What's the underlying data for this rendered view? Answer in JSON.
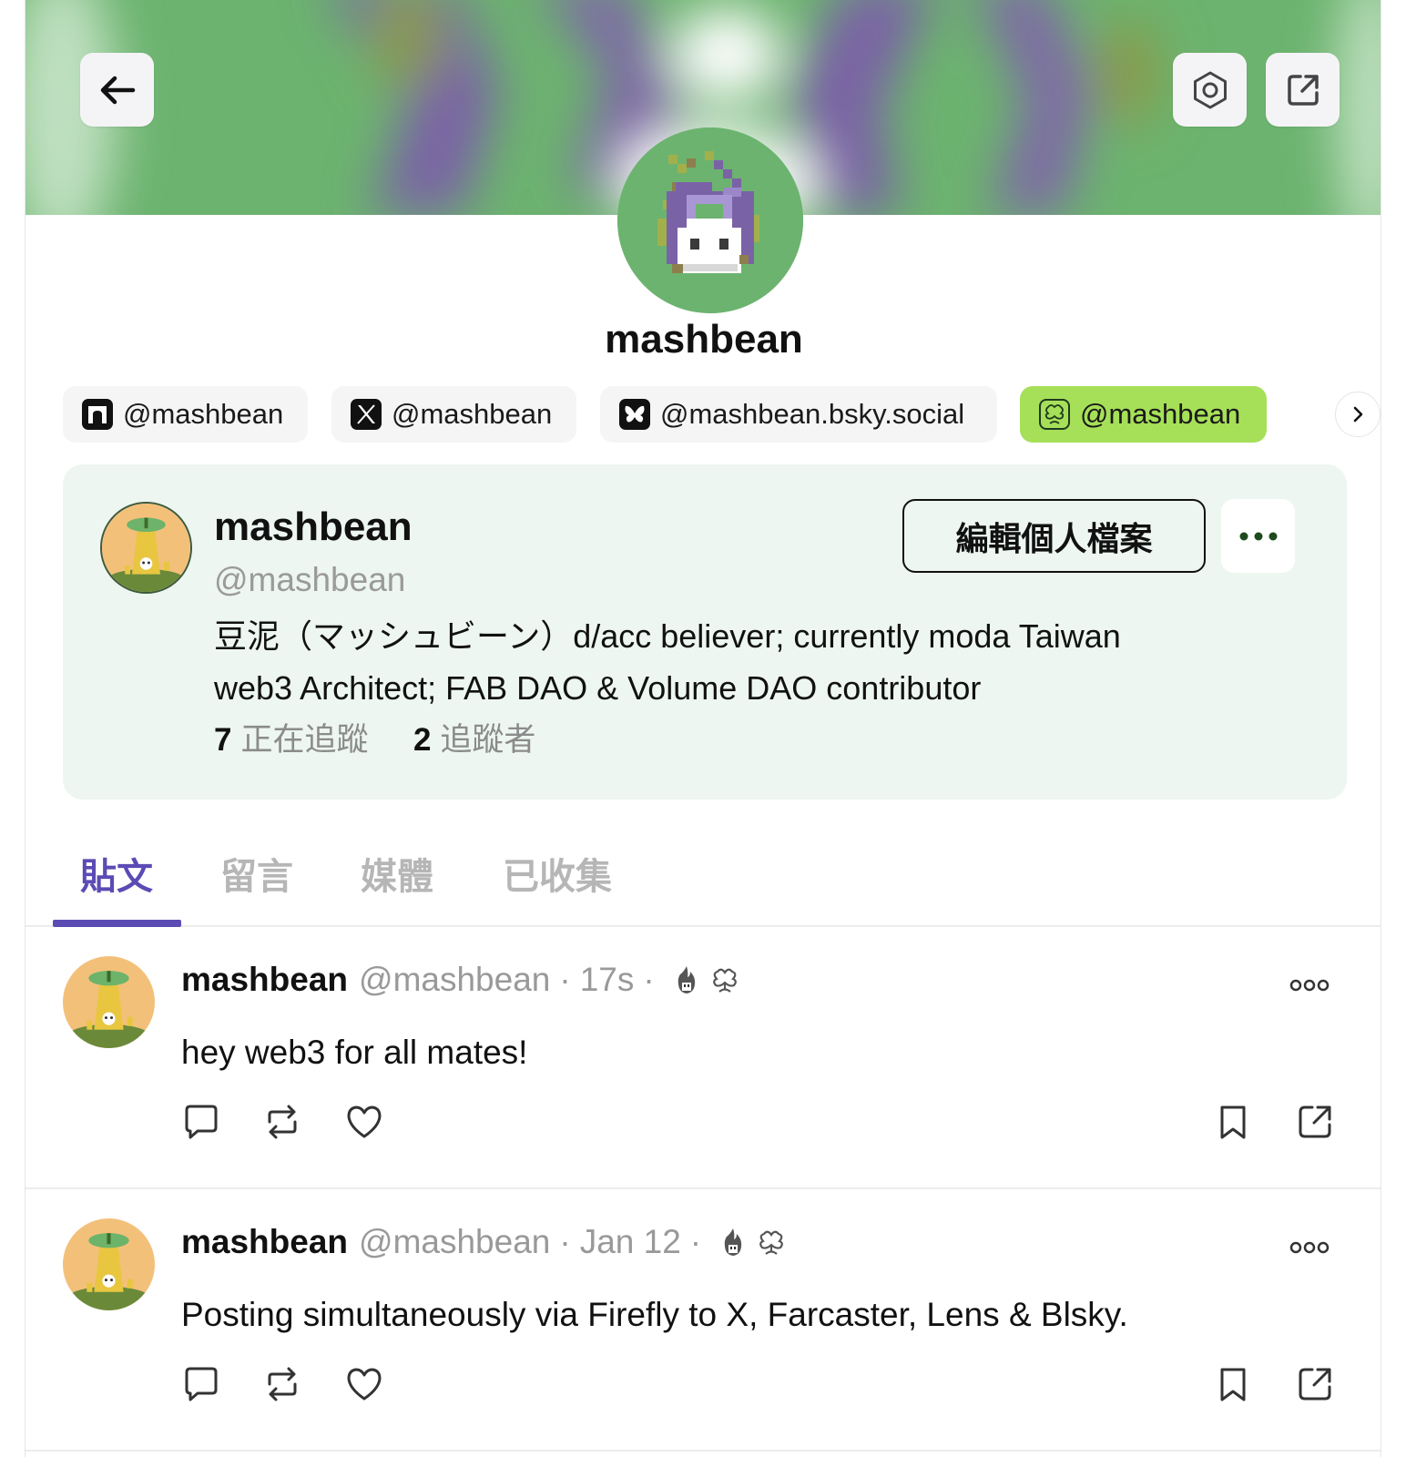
{
  "header": {
    "back_icon": "arrow-left-icon",
    "settings_icon": "gear-icon",
    "share_icon": "external-share-icon",
    "banner_colors": [
      "#6cb36f",
      "#7a62a6",
      "#ffffff"
    ]
  },
  "profile": {
    "display_name": "mashbean"
  },
  "social_chips": [
    {
      "platform_icon": "farcaster-icon",
      "label": "@mashbean"
    },
    {
      "platform_icon": "x-icon",
      "label": "@mashbean"
    },
    {
      "platform_icon": "bluesky-icon",
      "label": "@mashbean.bsky.social"
    },
    {
      "platform_icon": "lens-icon",
      "label": "@mashbean",
      "highlight_color": "#a6e058"
    }
  ],
  "card": {
    "name": "mashbean",
    "handle": "@mashbean",
    "bio_line1": "豆泥（マッシュビーン）d/acc believer; currently moda Taiwan",
    "bio_line2": "web3 Architect; FAB DAO & Volume DAO contributor",
    "following_count": "7",
    "following_label": "正在追蹤",
    "followers_count": "2",
    "followers_label": "追蹤者",
    "edit_button": "編輯個人檔案",
    "background": "#edf6f0"
  },
  "tabs": [
    {
      "label": "貼文",
      "active": true
    },
    {
      "label": "留言",
      "active": false
    },
    {
      "label": "媒體",
      "active": false
    },
    {
      "label": "已收集",
      "active": false
    }
  ],
  "accent_color": "#5b4bb4",
  "posts": [
    {
      "name": "mashbean",
      "handle": "@mashbean",
      "dot": "·",
      "time": "17s",
      "text": "hey web3 for all mates!"
    },
    {
      "name": "mashbean",
      "handle": "@mashbean",
      "dot": "·",
      "time": "Jan 12",
      "text": "Posting simultaneously via Firefly to X, Farcaster, Lens & Blsky."
    }
  ]
}
